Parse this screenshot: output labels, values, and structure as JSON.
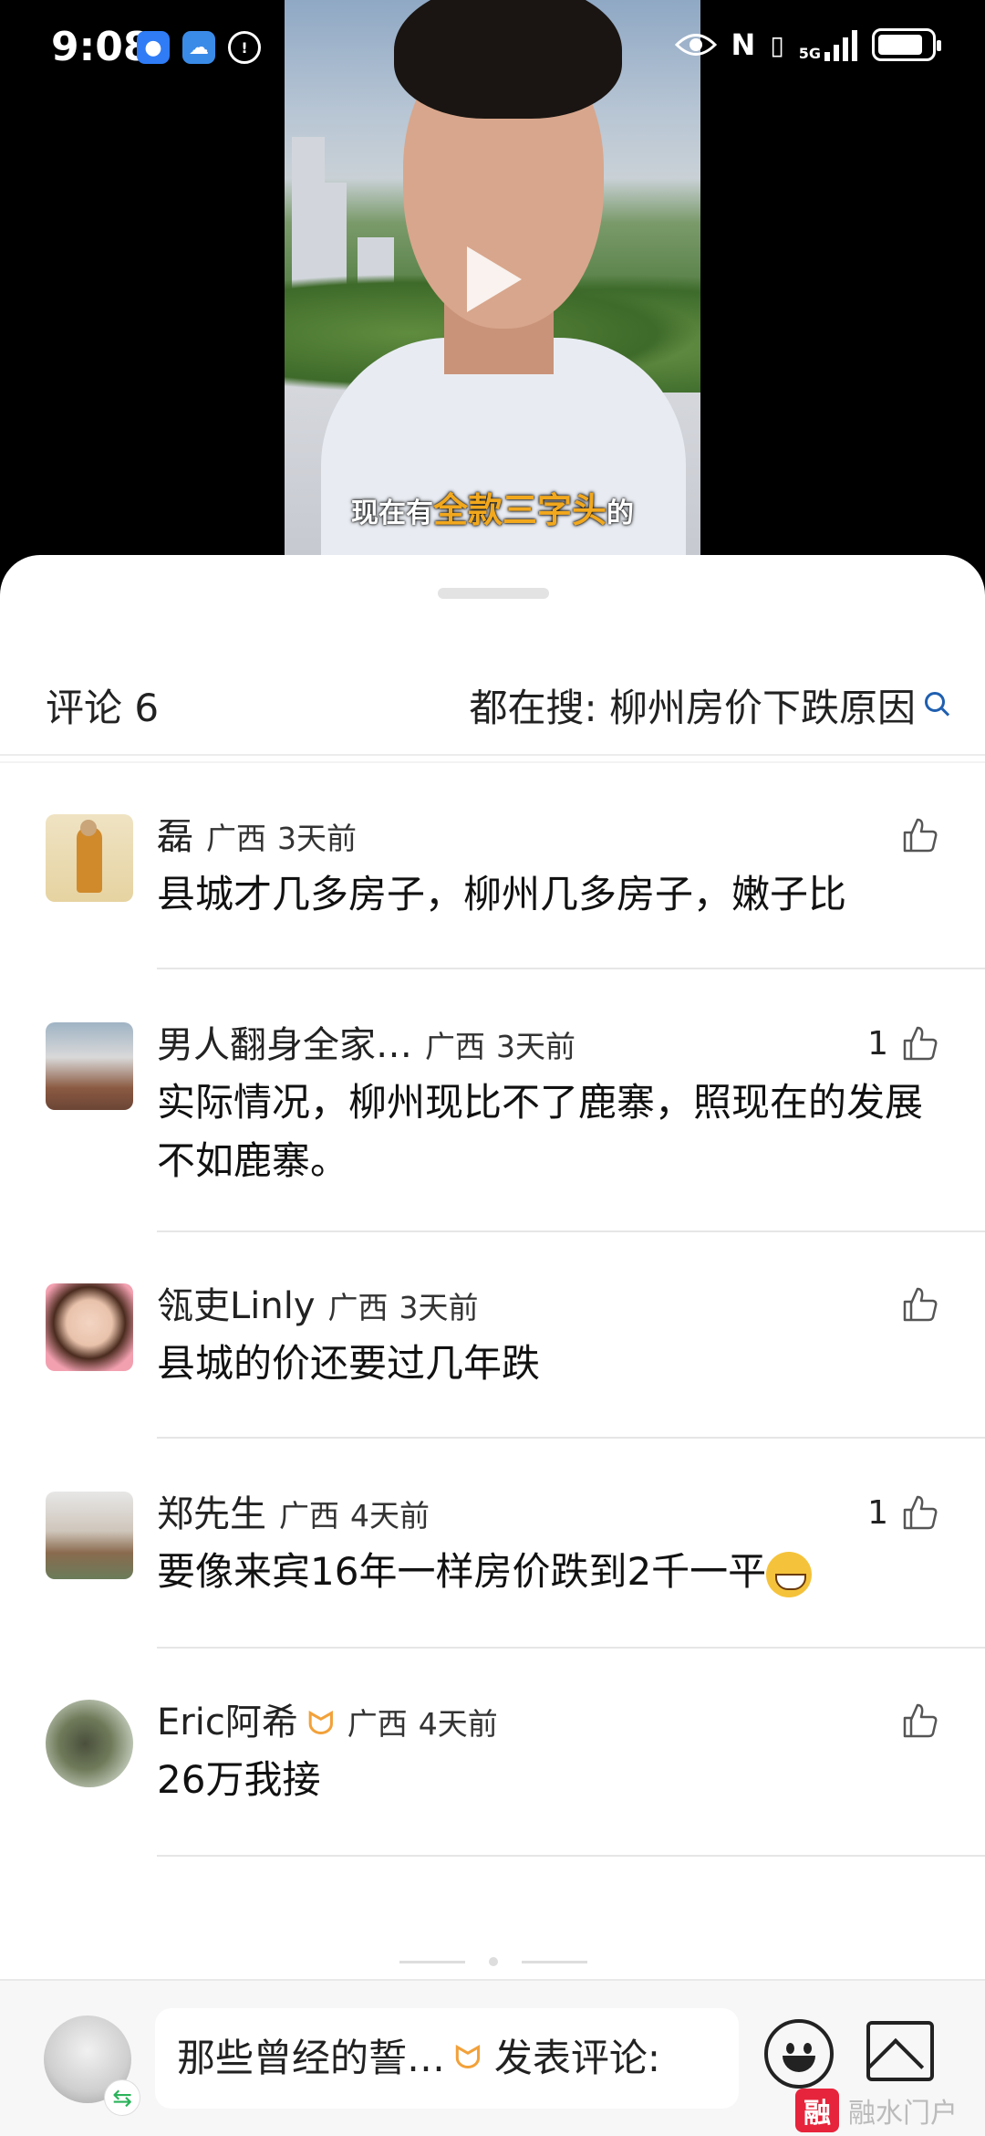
{
  "status_bar": {
    "time": "9:08",
    "network": "5G",
    "battery_level": 0.85
  },
  "video": {
    "caption_pre": "现在有",
    "caption_highlight": "全款三字头",
    "caption_post": "的"
  },
  "comments_panel": {
    "title": "评论 6",
    "trending_search": "都在搜: 柳州房价下跌原因"
  },
  "comments": [
    {
      "author": "磊",
      "location": "广西",
      "time": "3天前",
      "text": "县城才几多房子，柳州几多房子，嫩子比",
      "likes": ""
    },
    {
      "author": "男人翻身全家…",
      "location": "广西",
      "time": "3天前",
      "text": "实际情况，柳州现比不了鹿寨，照现在的发展不如鹿寨。",
      "likes": "1"
    },
    {
      "author": "瓴吏Linly",
      "location": "广西",
      "time": "3天前",
      "text": "县城的价还要过几年跌",
      "likes": ""
    },
    {
      "author": "郑先生",
      "location": "广西",
      "time": "4天前",
      "text": "要像来宾16年一样房价跌到2千一平",
      "likes": "1"
    },
    {
      "author": "Eric阿希",
      "location": "广西",
      "time": "4天前",
      "text": "26万我接",
      "likes": ""
    }
  ],
  "input_bar": {
    "placeholder": "那些曾经的誓…",
    "placeholder_suffix": "发表评论:"
  },
  "watermark": {
    "logo": "融",
    "text": "融水门户"
  },
  "colors": {
    "accent_gold": "#f2a81d",
    "search_blue": "#1f5fb0",
    "watermark_red": "#e6243b"
  }
}
